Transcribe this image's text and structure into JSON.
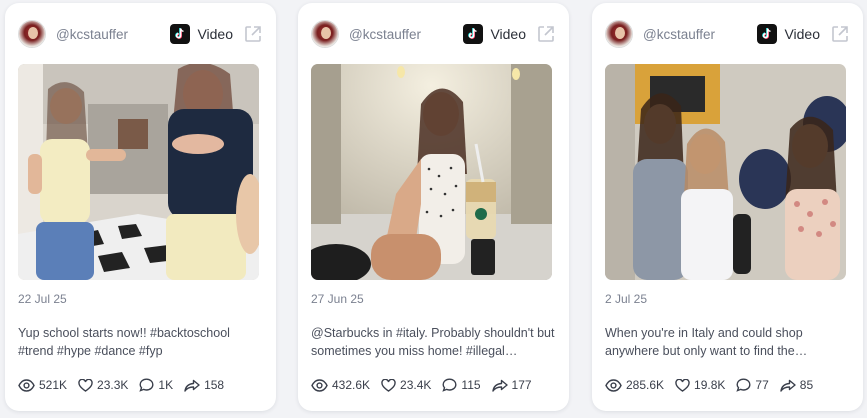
{
  "cards": [
    {
      "handle": "@kcstauffer",
      "platform_icon": "tiktok-icon",
      "type_label": "Video",
      "date": "22 Jul 25",
      "caption": "Yup school starts now!! #backtoschool #trend #hype #dance #fyp",
      "views": "521K",
      "likes": "23.3K",
      "comments": "1K",
      "shares": "158"
    },
    {
      "handle": "@kcstauffer",
      "platform_icon": "tiktok-icon",
      "type_label": "Video",
      "date": "27 Jun 25",
      "caption": "@Starbucks in #italy. Probably shouldn't but sometimes you miss home! #illegal…",
      "views": "432.6K",
      "likes": "23.4K",
      "comments": "115",
      "shares": "177"
    },
    {
      "handle": "@kcstauffer",
      "platform_icon": "tiktok-icon",
      "type_label": "Video",
      "date": "2 Jul 25",
      "caption": "When you're in Italy and could shop anywhere but only want to find the…",
      "views": "285.6K",
      "likes": "19.8K",
      "comments": "77",
      "shares": "85"
    }
  ],
  "colors": {
    "page_bg": "#f2f3f6",
    "card_bg": "#ffffff",
    "muted_text": "#7b8190",
    "body_text": "#4a4f5c"
  }
}
